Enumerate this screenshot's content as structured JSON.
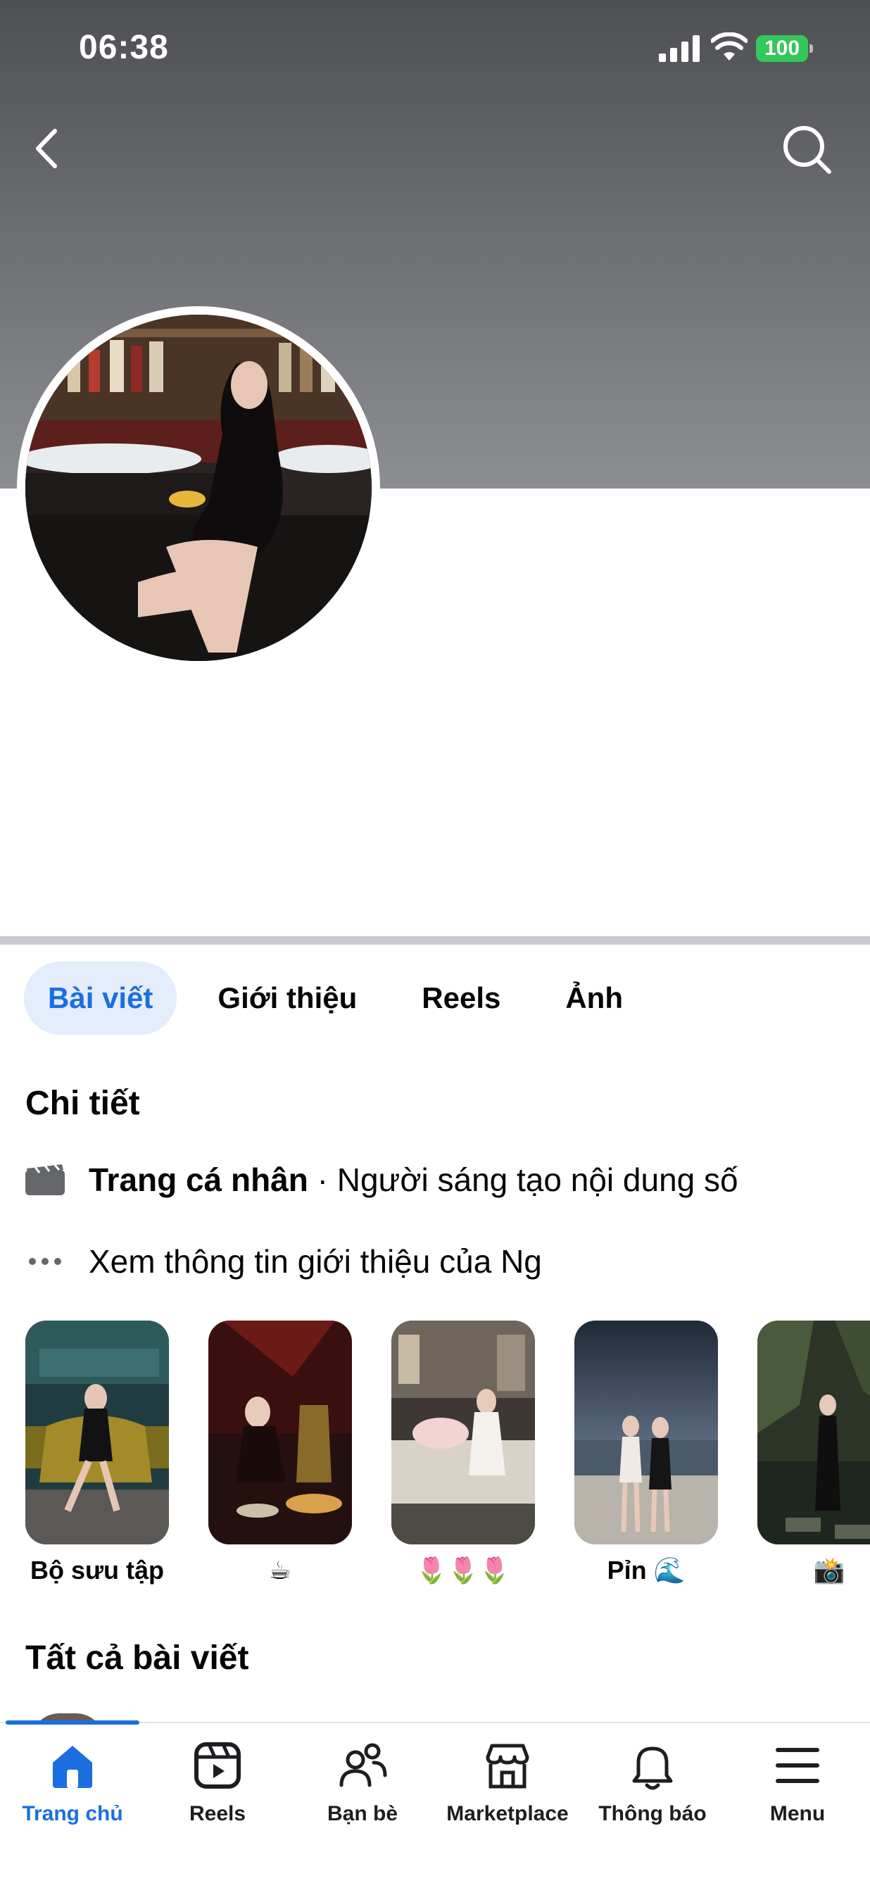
{
  "status_bar": {
    "time": "06:38",
    "battery": "100",
    "icons": [
      "signal-icon",
      "wifi-icon",
      "battery-icon"
    ]
  },
  "header": {
    "back_icon": "chevron-left-icon",
    "search_icon": "search-icon"
  },
  "tabs": [
    {
      "label": "Bài viết",
      "active": true
    },
    {
      "label": "Giới thiệu",
      "active": false
    },
    {
      "label": "Reels",
      "active": false
    },
    {
      "label": "Ảnh",
      "active": false
    }
  ],
  "details": {
    "title": "Chi tiết",
    "category_bold": "Trang cá nhân",
    "category_rest": " · Người sáng tạo nội dung số",
    "more_info": "Xem thông tin giới thiệu của Ng"
  },
  "highlights": [
    {
      "label": "Bộ sưu tập"
    },
    {
      "label": "☕"
    },
    {
      "label": "🌷🌷🌷"
    },
    {
      "label": "Pỉn 🌊"
    },
    {
      "label": "📸"
    }
  ],
  "posts": {
    "title": "Tất cả bài viết"
  },
  "bottom_nav": [
    {
      "label": "Trang chủ",
      "icon": "home-icon",
      "active": true
    },
    {
      "label": "Reels",
      "icon": "reels-icon",
      "active": false
    },
    {
      "label": "Bạn bè",
      "icon": "friends-icon",
      "active": false
    },
    {
      "label": "Marketplace",
      "icon": "marketplace-icon",
      "active": false
    },
    {
      "label": "Thông báo",
      "icon": "bell-icon",
      "active": false
    },
    {
      "label": "Menu",
      "icon": "menu-icon",
      "active": false
    }
  ],
  "colors": {
    "accent": "#1b6fe0",
    "active_tab_bg": "#e3edfb",
    "battery": "#34c759"
  }
}
